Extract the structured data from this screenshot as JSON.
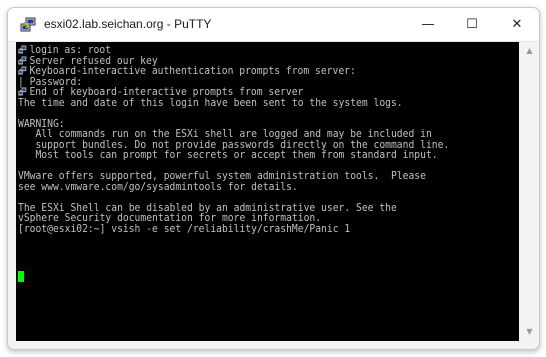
{
  "window": {
    "title": "esxi02.lab.seichan.org - PuTTY",
    "minimize_glyph": "—",
    "maximize_glyph": "☐",
    "close_glyph": "✕"
  },
  "terminal": {
    "lines": [
      {
        "icon": "putty-icon",
        "text": "login as: root"
      },
      {
        "icon": "putty-icon",
        "text": "Server refused our key"
      },
      {
        "icon": "putty-icon",
        "text": "Keyboard-interactive authentication prompts from server:"
      },
      {
        "icon": "",
        "text": "| Password:"
      },
      {
        "icon": "putty-icon",
        "text": "End of keyboard-interactive prompts from server"
      },
      {
        "icon": "",
        "text": "The time and date of this login have been sent to the system logs."
      },
      {
        "icon": "",
        "text": ""
      },
      {
        "icon": "",
        "text": "WARNING:"
      },
      {
        "icon": "",
        "text": "   All commands run on the ESXi shell are logged and may be included in"
      },
      {
        "icon": "",
        "text": "   support bundles. Do not provide passwords directly on the command line."
      },
      {
        "icon": "",
        "text": "   Most tools can prompt for secrets or accept them from standard input."
      },
      {
        "icon": "",
        "text": ""
      },
      {
        "icon": "",
        "text": "VMware offers supported, powerful system administration tools.  Please"
      },
      {
        "icon": "",
        "text": "see www.vmware.com/go/sysadmintools for details."
      },
      {
        "icon": "",
        "text": ""
      },
      {
        "icon": "",
        "text": "The ESXi Shell can be disabled by an administrative user. See the"
      },
      {
        "icon": "",
        "text": "vSphere Security documentation for more information."
      },
      {
        "icon": "",
        "text": "[root@esxi02:~] vsish -e set /reliability/crashMe/Panic 1"
      }
    ],
    "cursor_color": "#00ff00",
    "foreground": "#c0c0c0",
    "background": "#000000"
  },
  "scrollbar": {
    "up_glyph": "▲",
    "down_glyph": "▼"
  }
}
